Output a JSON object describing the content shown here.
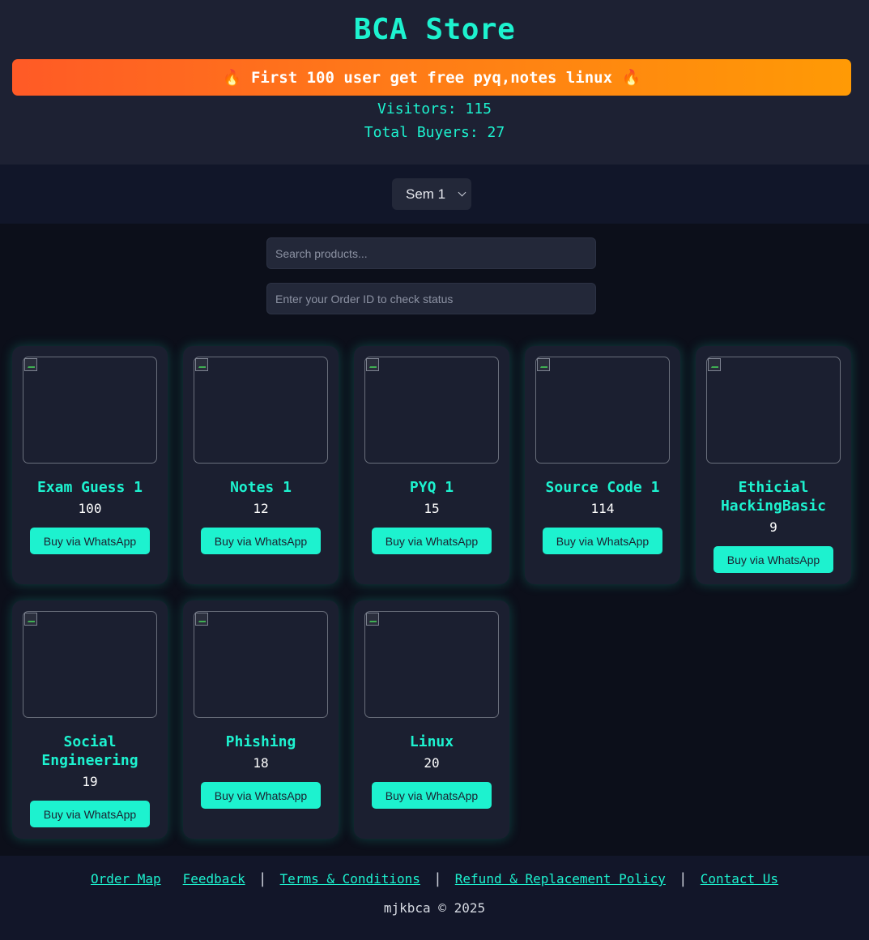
{
  "header": {
    "title": "BCA Store",
    "promo": "🔥 First 100 user get free pyq,notes linux 🔥",
    "visitors": "Visitors: 115",
    "buyers": "Total Buyers: 27"
  },
  "filter": {
    "semester_selected": "Sem 1"
  },
  "search": {
    "placeholder": "Search products...",
    "value": ""
  },
  "order_status": {
    "placeholder": "Enter your Order ID to check status",
    "value": ""
  },
  "products": [
    {
      "name": "Exam Guess 1",
      "price": "100",
      "button": "Buy via WhatsApp"
    },
    {
      "name": "Notes 1",
      "price": "12",
      "button": "Buy via WhatsApp"
    },
    {
      "name": "PYQ 1",
      "price": "15",
      "button": "Buy via WhatsApp"
    },
    {
      "name": "Source Code 1",
      "price": "114",
      "button": "Buy via WhatsApp"
    },
    {
      "name": "Ethicial HackingBasic",
      "price": "9",
      "button": "Buy via WhatsApp"
    },
    {
      "name": "Social Engineering",
      "price": "19",
      "button": "Buy via WhatsApp"
    },
    {
      "name": "Phishing",
      "price": "18",
      "button": "Buy via WhatsApp"
    },
    {
      "name": "Linux",
      "price": "20",
      "button": "Buy via WhatsApp"
    }
  ],
  "footer": {
    "links": [
      "Order Map",
      "Feedback",
      "Terms & Conditions",
      "Refund & Replacement Policy",
      "Contact Us"
    ],
    "separator": "|",
    "copyright": "mjkbca © 2025"
  },
  "colors": {
    "accent": "#1df2cf",
    "page_bg": "#0c0f1a",
    "header_bg": "#1d2133",
    "card_bg": "#1b1f30",
    "promo_start": "#ff5a26",
    "promo_end": "#ff9a05"
  }
}
